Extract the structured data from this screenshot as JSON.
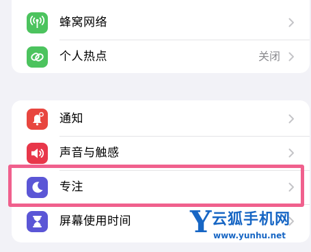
{
  "settings": {
    "group_top": [
      {
        "label": "蜂窝网络",
        "value": "",
        "icon": "antenna-icon",
        "color": "#4cc35e"
      },
      {
        "label": "个人热点",
        "value": "关闭",
        "icon": "link-icon",
        "color": "#4cc35e"
      }
    ],
    "group_bottom": [
      {
        "label": "通知",
        "value": "",
        "icon": "bell-icon",
        "color": "#e8463f"
      },
      {
        "label": "声音与触感",
        "value": "",
        "icon": "speaker-icon",
        "color": "#e8374a"
      },
      {
        "label": "专注",
        "value": "",
        "icon": "moon-icon",
        "color": "#5b56d6"
      },
      {
        "label": "屏幕使用时间",
        "value": "",
        "icon": "hourglass-icon",
        "color": "#5b56d6"
      }
    ]
  },
  "highlight": {
    "color": "#f0608d",
    "target": "专注"
  },
  "watermark": {
    "logo_letter": "Y",
    "brand": "云狐手机网",
    "url": "www.yunhu.net",
    "color": "#1766c4"
  }
}
